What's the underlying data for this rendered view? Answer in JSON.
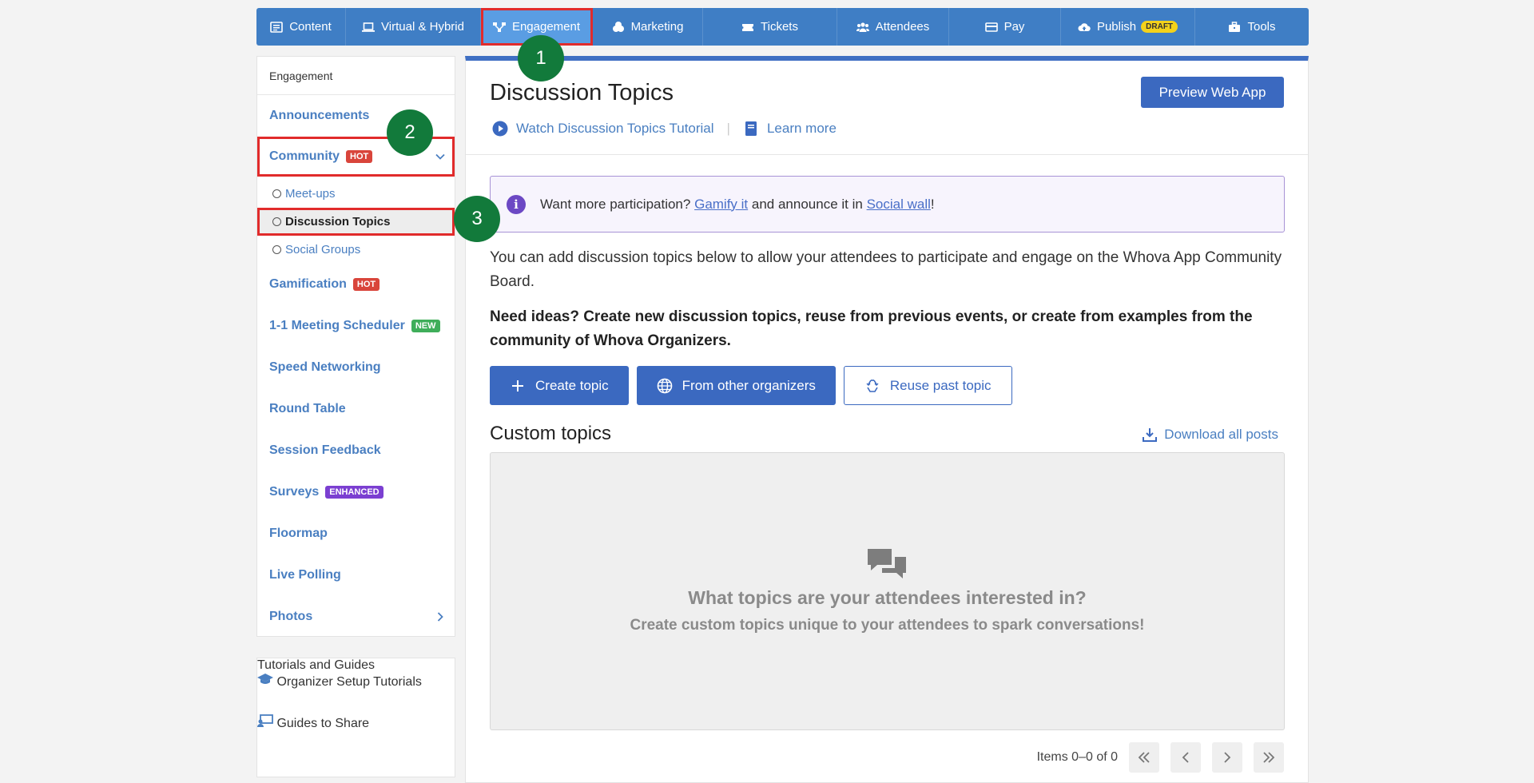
{
  "topnav": {
    "tabs": [
      {
        "label": "Content",
        "icon": "content-icon"
      },
      {
        "label": "Virtual & Hybrid",
        "icon": "laptop-icon"
      },
      {
        "label": "Engagement",
        "icon": "engagement-icon"
      },
      {
        "label": "Marketing",
        "icon": "marketing-icon"
      },
      {
        "label": "Tickets",
        "icon": "ticket-icon"
      },
      {
        "label": "Attendees",
        "icon": "attendees-icon"
      },
      {
        "label": "Pay",
        "icon": "pay-icon"
      },
      {
        "label": "Publish",
        "icon": "cloud-upload-icon",
        "badge": "DRAFT"
      },
      {
        "label": "Tools",
        "icon": "toolbox-icon"
      }
    ],
    "active": "Engagement"
  },
  "sidebar": {
    "section": "Engagement",
    "items": {
      "announcements": "Announcements",
      "community": "Community",
      "community_badge": "HOT",
      "meetups": "Meet-ups",
      "discussion_topics": "Discussion Topics",
      "social_groups": "Social Groups",
      "gamification": "Gamification",
      "gamification_badge": "HOT",
      "meeting_scheduler": "1-1 Meeting Scheduler",
      "meeting_badge": "NEW",
      "speed_networking": "Speed Networking",
      "round_table": "Round Table",
      "session_feedback": "Session Feedback",
      "surveys": "Surveys",
      "surveys_badge": "ENHANCED",
      "floormap": "Floormap",
      "live_polling": "Live Polling",
      "photos": "Photos"
    }
  },
  "sidebar2": {
    "section": "Tutorials and Guides",
    "setup": "Organizer Setup Tutorials",
    "guides": "Guides to Share"
  },
  "main": {
    "title": "Discussion Topics",
    "tutorial_link": "Watch Discussion Topics Tutorial",
    "learn_more": "Learn more",
    "preview_button": "Preview Web App",
    "info": {
      "pre": "Want more participation?",
      "link1": "Gamify it",
      "mid": "and announce it in",
      "link2": "Social wall",
      "post": "!"
    },
    "description": "You can add discussion topics below to allow your attendees to participate and engage on the Whova App Community Board.",
    "ideas": "Need ideas? Create new discussion topics, reuse from previous events, or create from examples from the community of Whova Organizers.",
    "create_topic": "Create topic",
    "from_other": "From other organizers",
    "reuse": "Reuse past topic",
    "custom_topics": "Custom topics",
    "download": "Download all posts",
    "empty_question": "What topics are your attendees interested in?",
    "empty_sub": "Create custom topics unique to your attendees to spark conversations!",
    "pager_text": "Items 0–0 of 0"
  },
  "steps": [
    "1",
    "2",
    "3"
  ]
}
